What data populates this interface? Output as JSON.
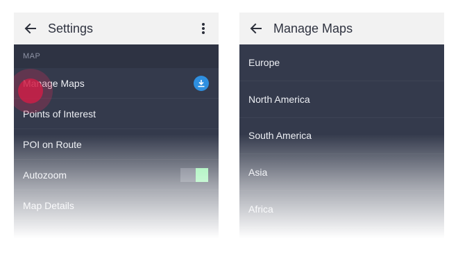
{
  "settings_screen": {
    "title": "Settings",
    "section_label": "MAP",
    "items": [
      {
        "label": "Manage Maps"
      },
      {
        "label": "Points of Interest"
      },
      {
        "label": "POI on Route"
      },
      {
        "label": "Autozoom",
        "toggle_on": true
      },
      {
        "label": "Map Details"
      }
    ]
  },
  "manage_screen": {
    "title": "Manage Maps",
    "items": [
      {
        "label": "Europe"
      },
      {
        "label": "North America"
      },
      {
        "label": "South America"
      },
      {
        "label": "Asia"
      },
      {
        "label": "Africa"
      }
    ]
  },
  "colors": {
    "appbar": "#f2f2f2",
    "list_background": "#343a4c",
    "download_badge": "#2e8fe0",
    "toggle_thumb": "#8ef0a8",
    "touch_indicator": "#d21e46"
  },
  "icons": {
    "back": "arrow-left-icon",
    "menu": "more-vertical-icon",
    "download": "download-icon"
  }
}
